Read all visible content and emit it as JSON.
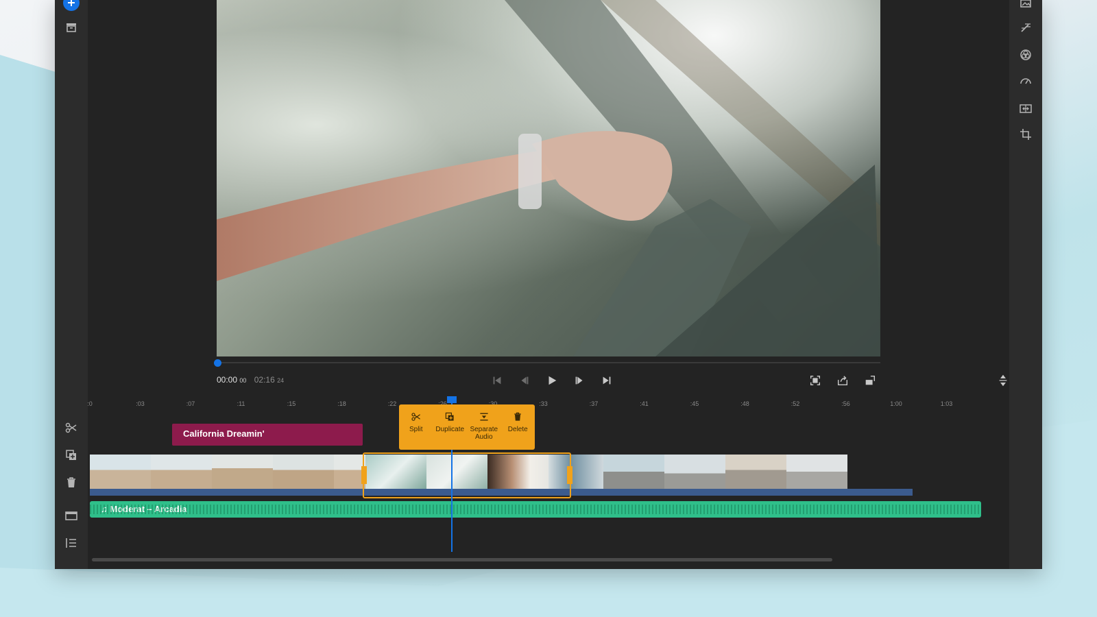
{
  "colors": {
    "accent_blue": "#1473e6",
    "selection_orange": "#f0a21b",
    "title_clip": "#8d1b4c",
    "audio_clip": "#2fbf8a"
  },
  "left_rail": {
    "icons": [
      "add-icon",
      "media-bin-icon"
    ]
  },
  "right_rail": {
    "icons": [
      "image-icon",
      "magic-wand-icon",
      "color-wheel-icon",
      "speed-icon",
      "transition-icon",
      "crop-icon"
    ]
  },
  "player": {
    "current_time": "00:00",
    "current_frames": "00",
    "total_time": "02:16",
    "total_frames": "24",
    "progress": 0.0
  },
  "transport": {
    "icons": [
      "go-to-start-icon",
      "step-back-icon",
      "play-icon",
      "step-forward-icon",
      "go-to-end-icon"
    ]
  },
  "view_tools": {
    "icons": [
      "fit-screen-icon",
      "share-icon",
      "aspect-ratio-icon",
      "collapse-panel-icon"
    ]
  },
  "ruler": {
    "ticks": [
      ":0",
      ":03",
      ":07",
      ":11",
      ":15",
      ":18",
      ":22",
      ":26",
      ":30",
      ":33",
      ":37",
      ":41",
      ":45",
      ":48",
      ":52",
      ":56",
      "1:00",
      "1:03"
    ]
  },
  "timeline_tools": {
    "icons": [
      "scissors-icon",
      "duplicate-icon",
      "trash-icon",
      "layout-icon",
      "list-icon"
    ]
  },
  "title_clip": {
    "label": "California Dreamin'"
  },
  "context_menu": {
    "items": [
      {
        "label": "Split",
        "icon": "scissors-icon"
      },
      {
        "label": "Duplicate",
        "icon": "duplicate-icon"
      },
      {
        "label": "Separate\nAudio",
        "icon": "separate-audio-icon"
      },
      {
        "label": "Delete",
        "icon": "trash-icon"
      }
    ]
  },
  "audio_clip": {
    "label": "♫ Moderat – Arcadia"
  }
}
